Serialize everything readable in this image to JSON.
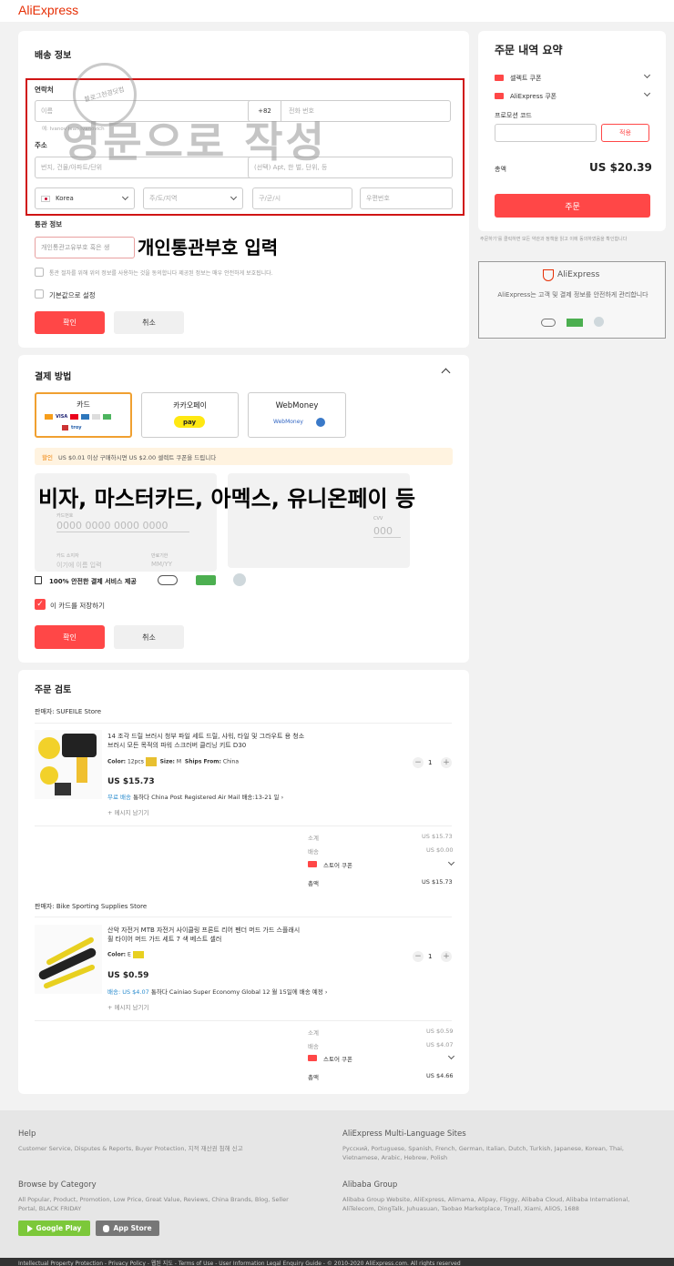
{
  "header": {
    "logo": "AliExpress"
  },
  "shipping": {
    "title": "배송 정보",
    "contact_label": "연락처",
    "name_placeholder": "이름",
    "name_hint": "예: Ivanov Ivan Ivanovich",
    "phone_code": "+82",
    "phone_placeholder": "전화 번호",
    "address_label": "주소",
    "street_placeholder": "번지, 건물/아파트/단위",
    "detail_placeholder": "(선택) Apt, 한 벌, 단위, 등",
    "country": "Korea",
    "province_placeholder": "주/도/지역",
    "city_placeholder": "구/군/시",
    "zip_placeholder": "우편번호",
    "customs_label": "통관 정보",
    "customs_placeholder": "개인통관고유부호 혹은 생",
    "consent_text": "통관 절차를 위해 위의 정보를 사용하는 것을 동의합니다 제공된 정보는 매우 안전하게 보호됩니다.",
    "default_label": "기본값으로 설정",
    "confirm": "확인",
    "cancel": "취소",
    "overlay_english": "영문으로 작성",
    "overlay_customs": "개인통관부호 입력",
    "stamp_text": "블로그천경딧컴"
  },
  "payment": {
    "title": "결제 방법",
    "methods": [
      {
        "label": "카드"
      },
      {
        "label": "카카오페이",
        "badge": "pay"
      },
      {
        "label": "WebMoney",
        "badge": "WebMoney"
      }
    ],
    "card_brands": [
      "VISA",
      "MC",
      "AMEX",
      "",
      "MIR",
      "",
      "troy"
    ],
    "promo_prefix": "할인",
    "promo_text": "US $0.01 이상 구매하시면 US $2.00 셀렉트 쿠폰을 드립니다",
    "card_number_label": "카드번호",
    "card_number_placeholder": "0000 0000 0000 0000",
    "cardholder_label": "카드 소지자",
    "cardholder_placeholder": "이기에 이름 입력",
    "expiry_label": "만료기한",
    "expiry_placeholder": "MM/YY",
    "cvv_label": "CVV",
    "cvv_placeholder": "000",
    "secure_text": "100% 안전한 결제 서비스 제공",
    "save_card": "이 카드를 저장하기",
    "confirm": "확인",
    "cancel": "취소",
    "overlay": "비자, 마스터카드, 아멕스, 유니온페이 등"
  },
  "review": {
    "title": "주문 검토",
    "stores": [
      {
        "seller": "판매자: SUFEILE Store",
        "product_title_1": "14 조각 드릴 브러시 청부 파일 세트 드릴, 샤워, 타일 및 그라우트 용 청소",
        "product_title_2": "브러시 모든 목적의 파워 스크러버 클리닝 키트 D30",
        "color_label": "Color:",
        "color_value": "12pcs",
        "size_label": "Size:",
        "size_value": "M",
        "ships_label": "Ships From:",
        "ships_value": "China",
        "price": "US $15.73",
        "shipping_free": "무료 배송",
        "shipping_text": "통하다 China Post Registered Air Mail 배송:13-21 일",
        "message": "+ 메시지 남기기",
        "qty": "1",
        "subtotal_label": "소계",
        "subtotal": "US $15.73",
        "ship_label": "배송",
        "ship_value": "US $0.00",
        "coupon_label": "스토어 쿠폰",
        "total_label": "총액",
        "total": "US $15.73"
      },
      {
        "seller": "판매자: Bike Sporting Supplies Store",
        "product_title_1": "산악 자전거 MTB 자전거 사이클링 프론트 리어 펜더 머드 가드 스플래시",
        "product_title_2": "휠 타이어 머드 가드 세트 7 색 베스트 셀러",
        "color_label": "Color:",
        "color_value": "E",
        "price": "US $0.59",
        "shipping_free": "배송: US $4.07",
        "shipping_text": "통하다 Cainiao Super Economy Global 12 월 15일에 배송 예정",
        "message": "+ 메시지 남기기",
        "qty": "1",
        "subtotal_label": "소계",
        "subtotal": "US $0.59",
        "ship_label": "배송",
        "ship_value": "US $4.07",
        "coupon_label": "스토어 쿠폰",
        "total_label": "총액",
        "total": "US $4.66"
      }
    ]
  },
  "summary": {
    "title": "주문 내역 요약",
    "select_coupon": "셀렉트 쿠폰",
    "aliexpress_coupon": "AliExpress 쿠폰",
    "promo_code_label": "프로모션 코드",
    "apply": "적용",
    "total_label": "총액",
    "total": "US $20.39",
    "order_button": "주문",
    "terms": "주문하기'를 클릭하면 모든 약관과 정책을 읽고 이에 동의하였음을 확인합니다",
    "security_brand": "AliExpress",
    "security_text": "AliExpress는 고객 및 결제 정보를 안전하게 관리합니다"
  },
  "footer": {
    "help_title": "Help",
    "help_text": "Customer Service, Disputes & Reports, Buyer Protection, 지적 재산권 침해 신고",
    "ml_title": "AliExpress Multi-Language Sites",
    "ml_text_1": "Русский, Portuguese, Spanish, French, German, Italian, Dutch, Turkish, Japanese, Korean, Thai,",
    "ml_text_2": "Vietnamese, Arabic, Hebrew, Polish",
    "browse_title": "Browse by Category",
    "browse_text_1": "All Popular, Product, Promotion, Low Price, Great Value, Reviews, China Brands, Blog, Seller",
    "browse_text_2": "Portal, BLACK FRIDAY",
    "group_title": "Alibaba Group",
    "group_text_1": "Alibaba Group Website, AliExpress, Alimama, Alipay, Fliggy, Alibaba Cloud, Alibaba International,",
    "group_text_2": "AliTelecom, DingTalk, Juhuasuan, Taobao Marketplace, Tmall, Xiami, AliOS, 1688",
    "google_play": "Google Play",
    "app_store": "App Store",
    "bottom_text": "Intellectual Property Protection - Privacy Policy - 웹된 지도 - Terms of Use - User Information Legal Enquiry Guide - © 2010-2020 AliExpress.com. All rights reserved"
  }
}
